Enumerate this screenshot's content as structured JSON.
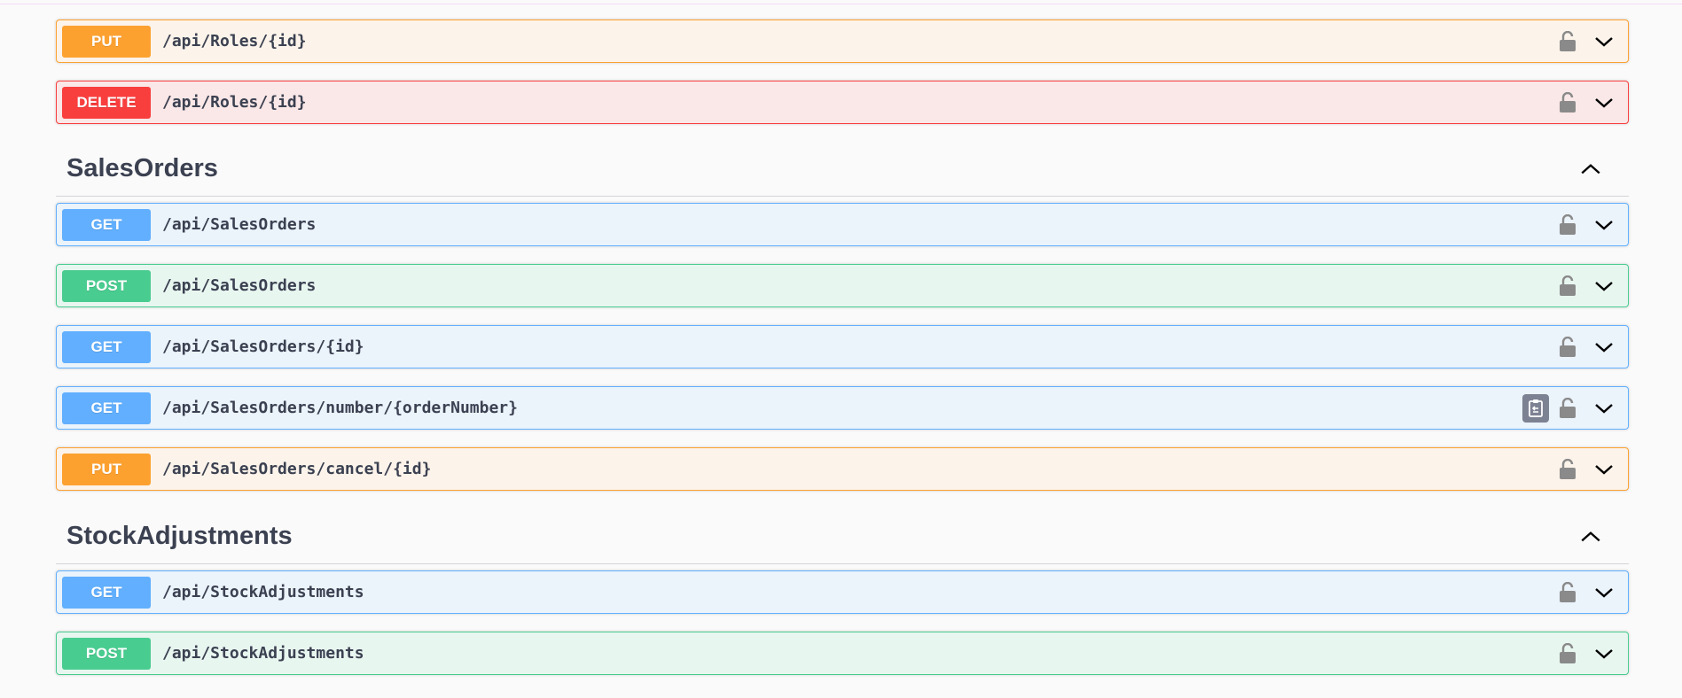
{
  "sections": [
    {
      "title": "SalesOrders",
      "collapse_icon": "chevron-up-icon"
    },
    {
      "title": "StockAdjustments",
      "collapse_icon": "chevron-up-icon"
    }
  ],
  "operations": [
    {
      "method": "PUT",
      "path": "/api/Roles/{id}",
      "group": "Roles"
    },
    {
      "method": "DELETE",
      "path": "/api/Roles/{id}",
      "group": "Roles"
    },
    {
      "method": "GET",
      "path": "/api/SalesOrders",
      "group": "SalesOrders"
    },
    {
      "method": "POST",
      "path": "/api/SalesOrders",
      "group": "SalesOrders"
    },
    {
      "method": "GET",
      "path": "/api/SalesOrders/{id}",
      "group": "SalesOrders"
    },
    {
      "method": "GET",
      "path": "/api/SalesOrders/number/{orderNumber}",
      "group": "SalesOrders",
      "has_copy_button": true
    },
    {
      "method": "PUT",
      "path": "/api/SalesOrders/cancel/{id}",
      "group": "SalesOrders"
    },
    {
      "method": "GET",
      "path": "/api/StockAdjustments",
      "group": "StockAdjustments"
    },
    {
      "method": "POST",
      "path": "/api/StockAdjustments",
      "group": "StockAdjustments"
    }
  ],
  "icons": {
    "lock": "lock-open-icon",
    "expand": "chevron-down-icon",
    "copy": "clipboard-copy-icon"
  },
  "colors": {
    "put": "#fca130",
    "delete": "#f93e3e",
    "get": "#61affe",
    "post": "#49cc90",
    "text": "#3b4151"
  }
}
